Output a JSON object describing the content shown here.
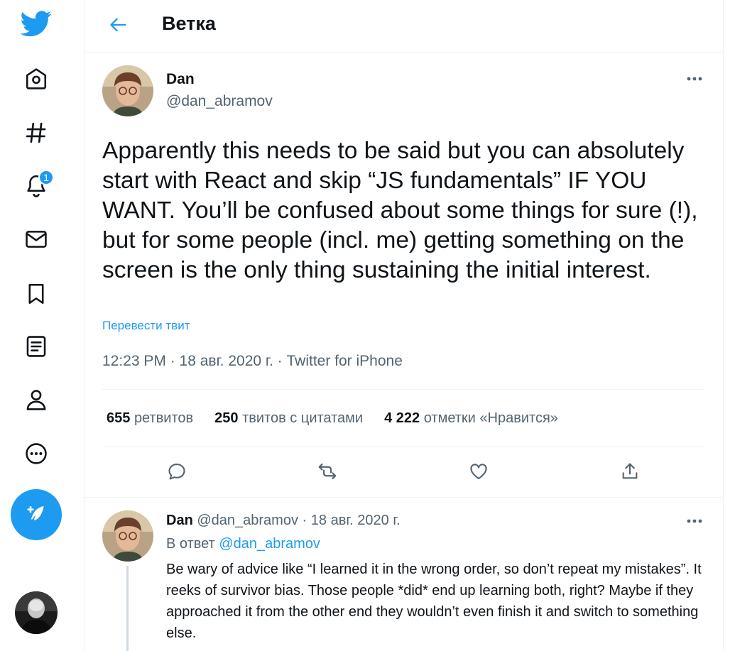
{
  "header": {
    "title": "Ветка"
  },
  "notifications": {
    "badge_count": "1"
  },
  "tweet": {
    "author_name": "Dan",
    "author_handle": "@dan_abramov",
    "text": "Apparently this needs to be said but you can absolutely start with React and skip “JS fundamentals” IF YOU WANT. You’ll be confused about some things for sure (!), but for some people (incl. me) getting something on the screen is the only thing sustaining the initial interest.",
    "translate_label": "Перевести твит",
    "meta": "12:23 PM · 18 авг. 2020 г. · Twitter for iPhone",
    "stats": {
      "retweets_count": "655",
      "retweets_label": "ретвитов",
      "quotes_count": "250",
      "quotes_label": "твитов с цитатами",
      "likes_count": "4 222",
      "likes_label": "отметки «Нравится»"
    }
  },
  "reply": {
    "author_name": "Dan",
    "author_handle": "@dan_abramov",
    "separator": "·",
    "date": "18 авг. 2020 г.",
    "reply_to_label": "В ответ",
    "reply_to_handle": "@dan_abramov",
    "text": "Be wary of advice like “I learned it in the wrong order, so don’t repeat my mistakes”. It reeks of survivor bias. Those people *did* end up learning both, right? Maybe if they approached it from the other end they wouldn’t even finish it and switch to something else."
  },
  "icons": {
    "logo": "twitter-bird-icon",
    "home": "home-icon",
    "explore": "hashtag-icon",
    "notifications": "bell-icon",
    "messages": "envelope-icon",
    "bookmarks": "bookmark-icon",
    "lists": "list-icon",
    "profile": "person-icon",
    "more": "more-circle-icon",
    "compose": "compose-feather-icon"
  },
  "colors": {
    "accent": "#1d9bf0",
    "text": "#0f1419",
    "muted": "#536471",
    "border": "#eff3f4"
  }
}
